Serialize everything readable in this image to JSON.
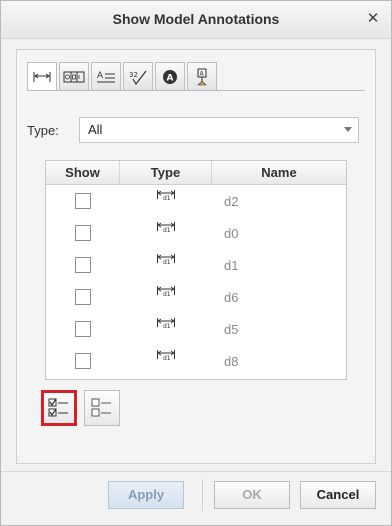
{
  "dialog": {
    "title": "Show Model Annotations",
    "close_icon": "close-icon"
  },
  "tabs": [
    {
      "icon": "dimension-icon",
      "active": true
    },
    {
      "icon": "datum-target-icon",
      "active": false
    },
    {
      "icon": "note-icon",
      "active": false
    },
    {
      "icon": "surface-finish-icon",
      "active": false
    },
    {
      "icon": "symbol-icon",
      "active": false
    },
    {
      "icon": "datum-feature-icon",
      "active": false
    }
  ],
  "filter": {
    "label": "Type:",
    "value": "All"
  },
  "table": {
    "columns": [
      "Show",
      "Type",
      "Name"
    ],
    "rows": [
      {
        "show": false,
        "type_icon": "dimension-type-icon",
        "name": "d2"
      },
      {
        "show": false,
        "type_icon": "dimension-type-icon",
        "name": "d0"
      },
      {
        "show": false,
        "type_icon": "dimension-type-icon",
        "name": "d1"
      },
      {
        "show": false,
        "type_icon": "dimension-type-icon",
        "name": "d6"
      },
      {
        "show": false,
        "type_icon": "dimension-type-icon",
        "name": "d5"
      },
      {
        "show": false,
        "type_icon": "dimension-type-icon",
        "name": "d8"
      }
    ]
  },
  "selection_buttons": {
    "select_all_icon": "select-all-icon",
    "deselect_all_icon": "deselect-all-icon",
    "highlight_color": "#d61f26"
  },
  "footer": {
    "apply_label": "Apply",
    "ok_label": "OK",
    "cancel_label": "Cancel"
  }
}
